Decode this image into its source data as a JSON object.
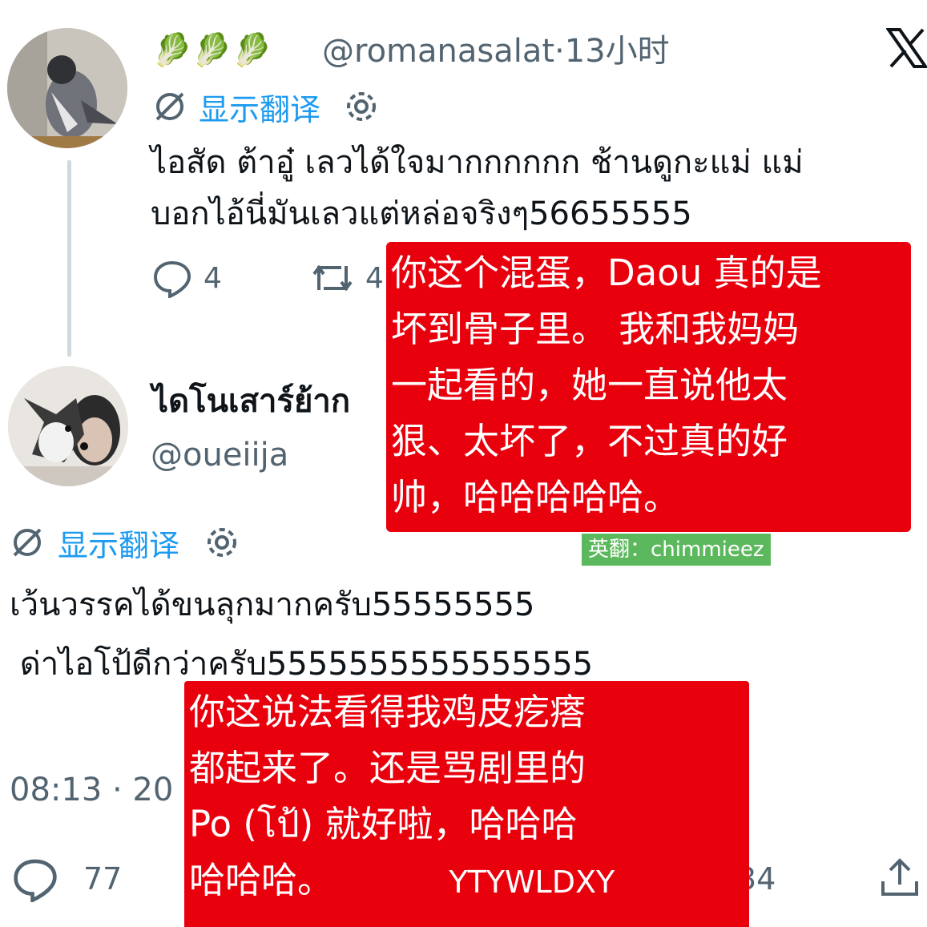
{
  "app": {
    "logo": "x-logo-icon"
  },
  "tweet1": {
    "emoji": [
      "🥬",
      "🥬",
      "🥬"
    ],
    "handle_time": "@romanasalat·13小时",
    "translate": "显示翻译",
    "text_line1": "ไอสัด ต้าอู๋ เลวได้ใจมากกกกกก ช้านดูกะแม่ แม่",
    "text_line2": "บอกไอ้นี่มันเลวแต่หล่อจริงๆ56655555",
    "replies": "4",
    "retweets": "4"
  },
  "tweet2": {
    "name": "ไดโนเสาร์ย้าก",
    "handle": "@oueiija",
    "translate": "显示翻译",
    "text_line1": "เว้นวรรคได้ขนลุกมากครับ55555555",
    "text_line2": " ด่าไอโป้ดีกว่าครับ5555555555555555",
    "time": "08:13 · 20",
    "replies": "77",
    "likes_partial": "34"
  },
  "overlay1": {
    "lines": [
      "你这个混蛋，Daou 真的是",
      "坏到骨子里。 我和我妈妈",
      "一起看的，她一直说他太",
      "狠、太坏了，不过真的好",
      "帅，哈哈哈哈哈。"
    ],
    "credit": "英翻：chimmieez"
  },
  "overlay2": {
    "lines": [
      "你这说法看得我鸡皮疙瘩",
      "都起来了。还是骂剧里的",
      "Po (โป้) 就好啦，哈哈哈",
      "哈哈哈。"
    ],
    "signature": "YTYWLDXY"
  },
  "colors": {
    "red": "#e8000d",
    "green": "#5cb85c",
    "link": "#1d9bf0",
    "secondary": "#536471"
  }
}
